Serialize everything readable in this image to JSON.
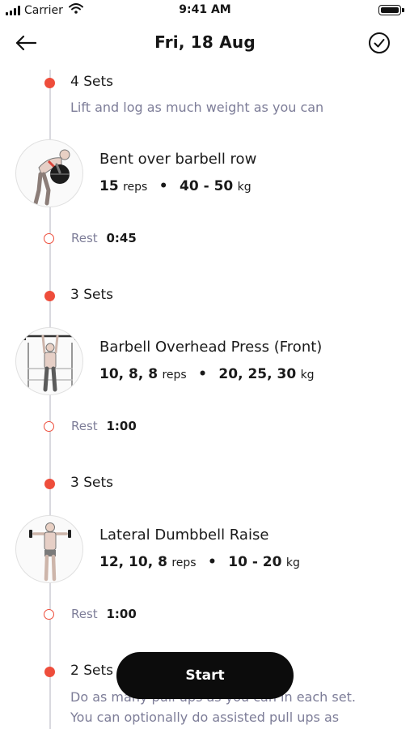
{
  "status_bar": {
    "carrier": "Carrier",
    "time": "9:41 AM"
  },
  "nav": {
    "title": "Fri, 18 Aug",
    "back_icon": "arrow-left-icon",
    "done_icon": "check-circle-icon"
  },
  "colors": {
    "accent": "#ee4d3b",
    "muted": "#7d7d98",
    "timeline": "#d9d9df",
    "button": "#0c0c0c"
  },
  "blocks": [
    {
      "sets": "4 Sets",
      "description": "Lift and log as much weight as you can",
      "exercise": {
        "name": "Bent over barbell row",
        "reps": "15",
        "reps_unit": "reps",
        "weight": "40 - 50",
        "weight_unit": "kg",
        "icon": "bent-over-row-figure"
      },
      "rest": {
        "label": "Rest",
        "value": "0:45"
      }
    },
    {
      "sets": "3 Sets",
      "exercise": {
        "name": "Barbell Overhead Press (Front)",
        "reps": "10, 8, 8",
        "reps_unit": "reps",
        "weight": "20, 25, 30",
        "weight_unit": "kg",
        "icon": "overhead-press-figure"
      },
      "rest": {
        "label": "Rest",
        "value": "1:00"
      }
    },
    {
      "sets": "3 Sets",
      "exercise": {
        "name": "Lateral Dumbbell Raise",
        "reps": "12, 10, 8",
        "reps_unit": "reps",
        "weight": "10 - 20",
        "weight_unit": "kg",
        "icon": "lateral-raise-figure"
      },
      "rest": {
        "label": "Rest",
        "value": "1:00"
      }
    },
    {
      "sets": "2 Sets",
      "description_lines": [
        "Do as many pull ups as you can in each set.",
        "You can optionally do assisted pull ups as"
      ]
    }
  ],
  "start_button": {
    "label": "Start"
  }
}
